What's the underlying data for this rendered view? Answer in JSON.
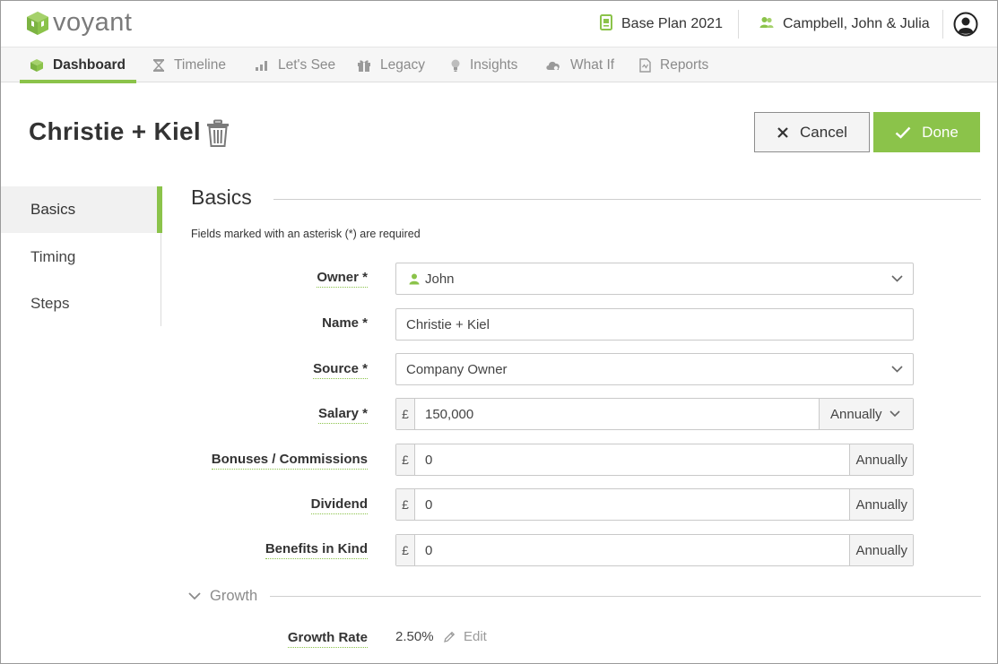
{
  "header": {
    "logo_text": "voyant",
    "plan_name": "Base Plan 2021",
    "client_name": "Campbell, John & Julia",
    "brand_color": "#8bc34a"
  },
  "nav": {
    "tabs": [
      {
        "label": "Dashboard",
        "icon": "cube-icon",
        "active": true
      },
      {
        "label": "Timeline",
        "icon": "hourglass-icon"
      },
      {
        "label": "Let's See",
        "icon": "bar-chart-icon"
      },
      {
        "label": "Legacy",
        "icon": "gift-icon"
      },
      {
        "label": "Insights",
        "icon": "lightbulb-icon"
      },
      {
        "label": "What If",
        "icon": "scenario-cloud-icon"
      },
      {
        "label": "Reports",
        "icon": "document-icon"
      }
    ]
  },
  "page": {
    "title": "Christie + Kiel",
    "cancel_label": "Cancel",
    "done_label": "Done"
  },
  "sidebar": {
    "items": [
      {
        "label": "Basics",
        "active": true
      },
      {
        "label": "Timing"
      },
      {
        "label": "Steps"
      }
    ]
  },
  "form": {
    "section_title": "Basics",
    "required_note": "Fields marked with an asterisk (*) are required",
    "owner": {
      "label": "Owner *",
      "value": "John"
    },
    "name": {
      "label": "Name *",
      "value": "Christie + Kiel"
    },
    "source": {
      "label": "Source *",
      "value": "Company Owner"
    },
    "salary": {
      "label": "Salary *",
      "currency": "£",
      "value": "150,000",
      "frequency": "Annually"
    },
    "bonuses": {
      "label": "Bonuses / Commissions",
      "currency": "£",
      "value": "0",
      "frequency": "Annually"
    },
    "dividend": {
      "label": "Dividend",
      "currency": "£",
      "value": "0",
      "frequency": "Annually"
    },
    "benefits": {
      "label": "Benefits in Kind",
      "currency": "£",
      "value": "0",
      "frequency": "Annually"
    }
  },
  "growth": {
    "section_title": "Growth",
    "rate_label": "Growth Rate",
    "rate_value": "2.50%",
    "edit_label": "Edit"
  }
}
